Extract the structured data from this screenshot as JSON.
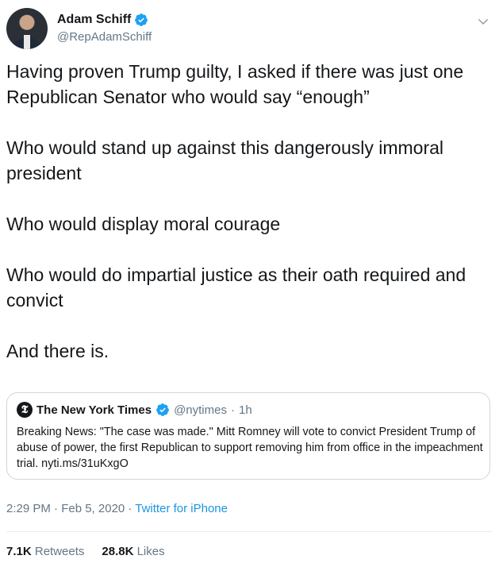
{
  "author": {
    "display_name": "Adam Schiff",
    "handle": "@RepAdamSchiff",
    "verified": true
  },
  "tweet": {
    "paragraphs": [
      "Having proven Trump guilty, I asked if there was just one Republican Senator who would say “enough”",
      "Who would stand up against this dangerously immoral president",
      "Who would display moral courage",
      "Who would do impartial justice as their oath required and convict",
      "And there is."
    ]
  },
  "quoted_tweet": {
    "logo": "𝕿",
    "display_name": "The New York Times",
    "handle": "@nytimes",
    "separator": "·",
    "time": "1h",
    "text": "Breaking News: \"The case was made.\" Mitt Romney will vote to convict President Trump of abuse of power, the first Republican to support removing him from office in the impeachment trial. nyti.ms/31uKxgO"
  },
  "meta": {
    "timestamp": "2:29 PM · Feb 5, 2020",
    "separator": "·",
    "source": "Twitter for iPhone"
  },
  "stats": {
    "retweets_count": "7.1K",
    "retweets_label": "Retweets",
    "likes_count": "28.8K",
    "likes_label": "Likes"
  },
  "colors": {
    "accent": "#1b95e0",
    "text": "#14171a",
    "secondary": "#657786",
    "border": "#ccd6dd"
  },
  "icons": [
    "verified-badge-icon",
    "chevron-down-icon",
    "nyt-logo-icon"
  ]
}
